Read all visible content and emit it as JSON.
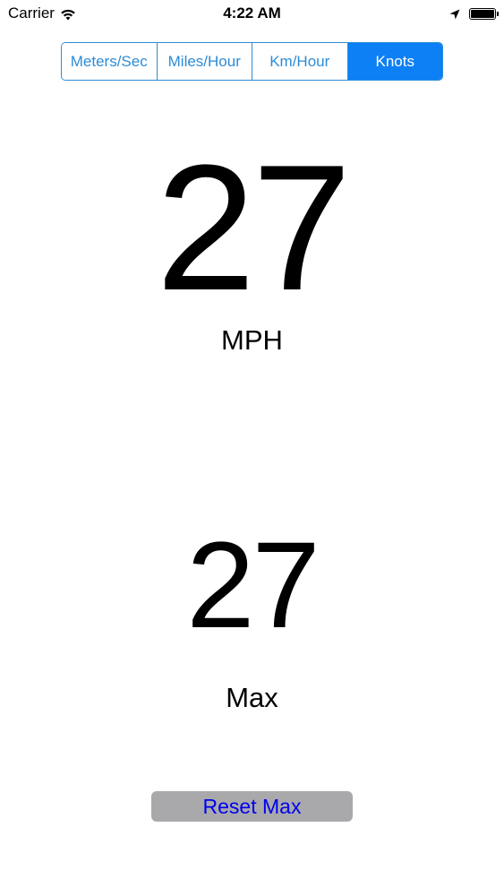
{
  "status_bar": {
    "carrier": "Carrier",
    "time": "4:22 AM",
    "battery_level": 1.0,
    "icons": [
      "wifi-icon",
      "location-arrow-icon",
      "battery-icon"
    ]
  },
  "units": {
    "segments": [
      {
        "label": "Meters/Sec",
        "selected": false
      },
      {
        "label": "Miles/Hour",
        "selected": false
      },
      {
        "label": "Km/Hour",
        "selected": false
      },
      {
        "label": "Knots",
        "selected": true
      }
    ]
  },
  "speed": {
    "value": "27",
    "unit": "MPH"
  },
  "max": {
    "value": "27",
    "label": "Max"
  },
  "actions": {
    "reset_label": "Reset Max"
  },
  "colors": {
    "accent": "#0d80f5",
    "segment_border": "#2d8cd6",
    "button_bg": "#a9a9ab",
    "button_text": "#0000ee"
  }
}
